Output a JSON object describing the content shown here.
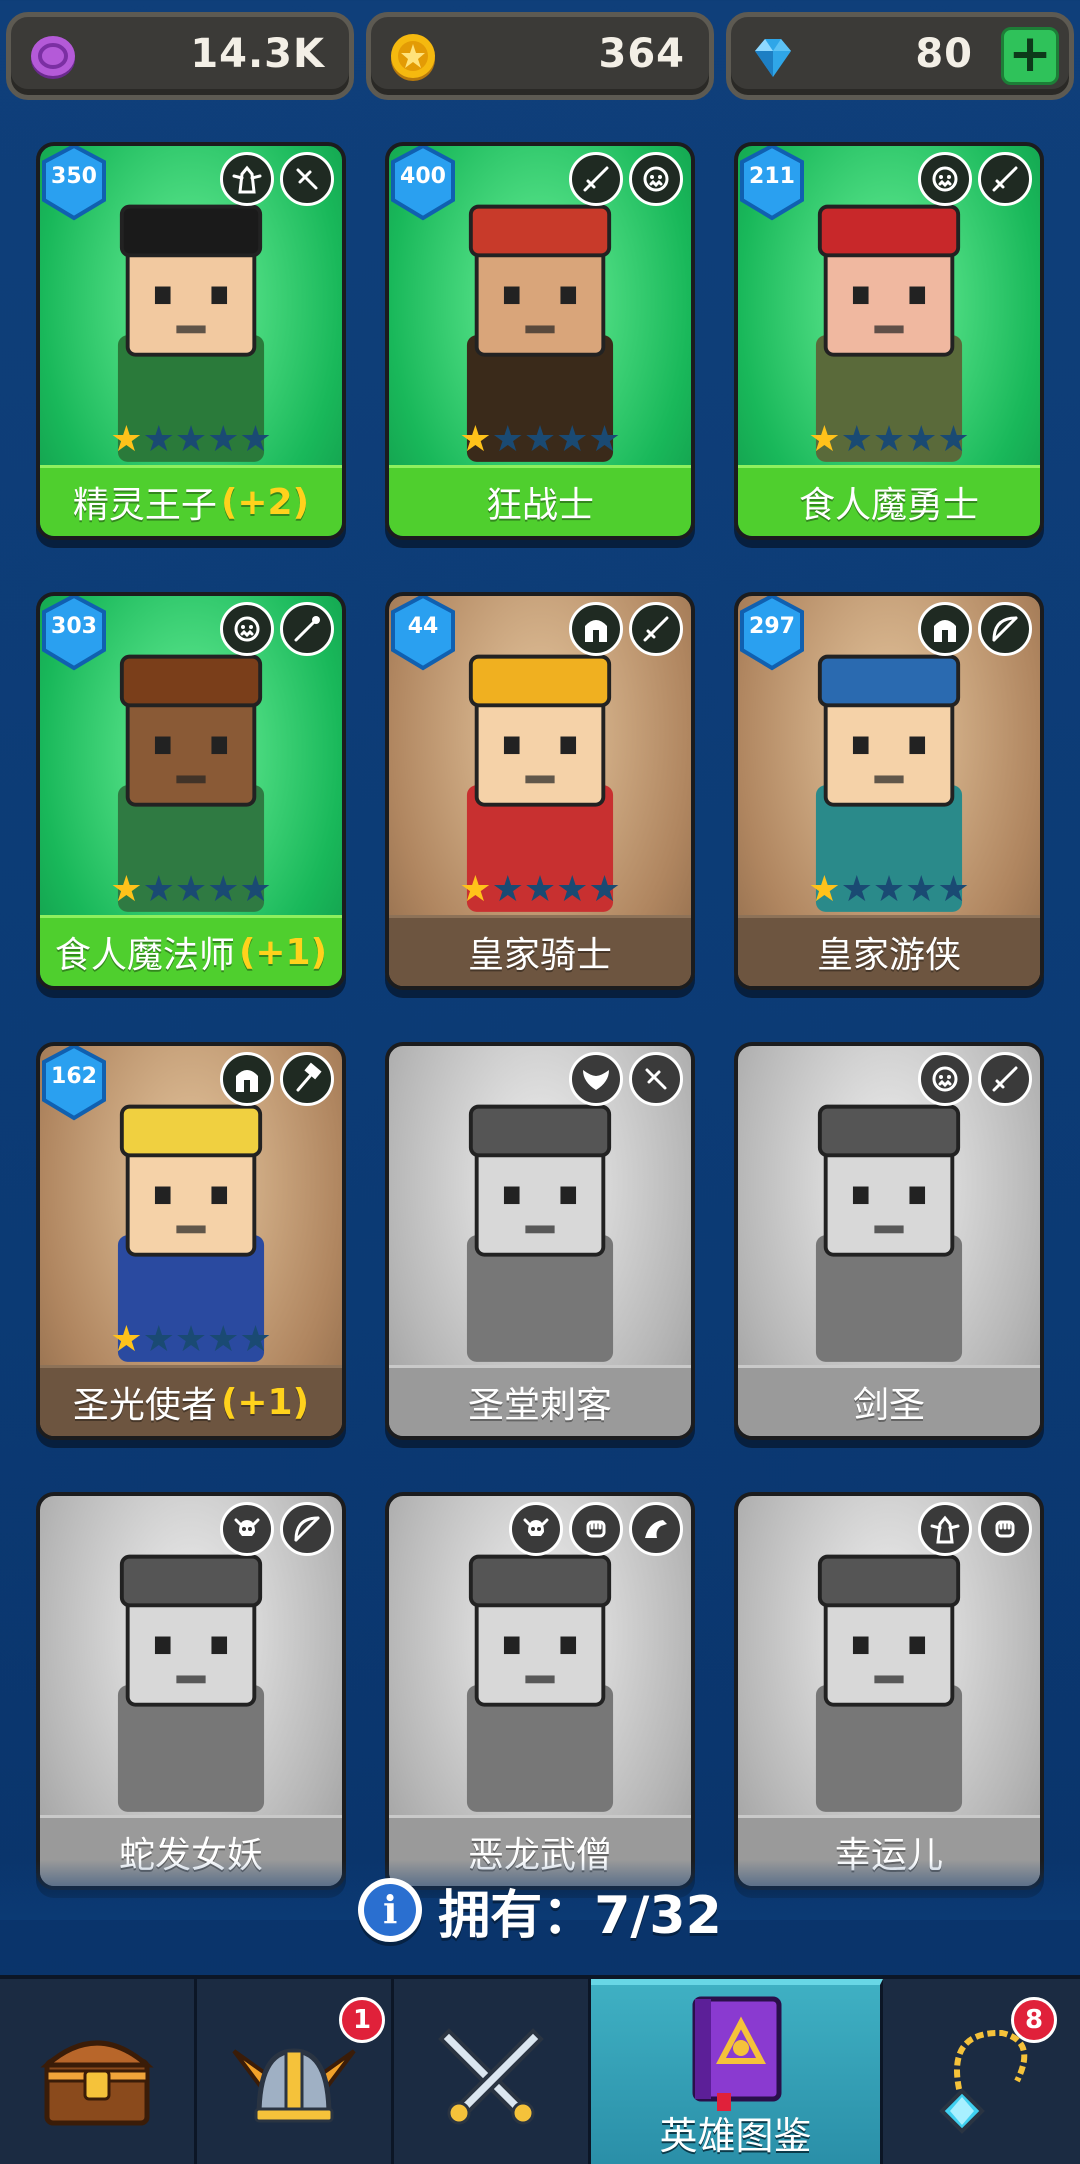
{
  "currency": {
    "purple": "14.3K",
    "gold": "364",
    "gems": "80"
  },
  "heroes": [
    {
      "level": "350",
      "name": "精灵王子",
      "bonus": "(+2)",
      "stars": 1,
      "owned": true,
      "bg": "green",
      "badges": [
        "elf-class-icon",
        "dagger-icon"
      ]
    },
    {
      "level": "400",
      "name": "狂战士",
      "bonus": "",
      "stars": 1,
      "owned": true,
      "bg": "green",
      "badges": [
        "sword-icon",
        "orc-class-icon"
      ]
    },
    {
      "level": "211",
      "name": "食人魔勇士",
      "bonus": "",
      "stars": 1,
      "owned": true,
      "bg": "green",
      "badges": [
        "orc-class-icon",
        "sword-icon"
      ]
    },
    {
      "level": "303",
      "name": "食人魔法师",
      "bonus": "(+1)",
      "stars": 1,
      "owned": true,
      "bg": "green",
      "badges": [
        "orc-class-icon",
        "staff-icon"
      ]
    },
    {
      "level": "44",
      "name": "皇家骑士",
      "bonus": "",
      "stars": 1,
      "owned": true,
      "bg": "brown",
      "badges": [
        "helmet-icon",
        "sword-icon"
      ]
    },
    {
      "level": "297",
      "name": "皇家游侠",
      "bonus": "",
      "stars": 1,
      "owned": true,
      "bg": "brown",
      "badges": [
        "helmet-icon",
        "bow-icon"
      ]
    },
    {
      "level": "162",
      "name": "圣光使者",
      "bonus": "(+1)",
      "stars": 1,
      "owned": true,
      "bg": "brown",
      "badges": [
        "helmet-icon",
        "hammer-icon"
      ]
    },
    {
      "level": "",
      "name": "圣堂刺客",
      "bonus": "",
      "stars": 0,
      "owned": false,
      "bg": "gray",
      "badges": [
        "wing-class-icon",
        "dagger-icon"
      ]
    },
    {
      "level": "",
      "name": "剑圣",
      "bonus": "",
      "stars": 0,
      "owned": false,
      "bg": "gray",
      "badges": [
        "orc-class-icon",
        "sword-icon"
      ]
    },
    {
      "level": "",
      "name": "蛇发女妖",
      "bonus": "",
      "stars": 0,
      "owned": false,
      "bg": "gray",
      "badges": [
        "skull-class-icon",
        "bow-icon"
      ]
    },
    {
      "level": "",
      "name": "恶龙武僧",
      "bonus": "",
      "stars": 0,
      "owned": false,
      "bg": "gray",
      "badges": [
        "skull-class-icon",
        "fist-icon",
        "dragon-icon"
      ]
    },
    {
      "level": "",
      "name": "幸运儿",
      "bonus": "",
      "stars": 0,
      "owned": false,
      "bg": "gray",
      "badges": [
        "elf-class-icon",
        "fist-icon"
      ]
    }
  ],
  "owned_label": "拥有：7/32",
  "nav": {
    "items": [
      {
        "icon": "treasure-chest-icon",
        "label": "",
        "notif": ""
      },
      {
        "icon": "viking-helmet-icon",
        "label": "",
        "notif": "1"
      },
      {
        "icon": "crossed-swords-icon",
        "label": "",
        "notif": ""
      },
      {
        "icon": "hero-book-icon",
        "label": "英雄图鉴",
        "notif": ""
      },
      {
        "icon": "amulet-icon",
        "label": "",
        "notif": "8"
      }
    ]
  },
  "colors": {
    "background": "#0b3a74",
    "owned_green": "#4fcf2e",
    "owned_brown": "#6d5540",
    "locked_gray": "#9a9a9a",
    "bonus_yellow": "#ffd21c",
    "nav_active": "#3fb0c3"
  }
}
